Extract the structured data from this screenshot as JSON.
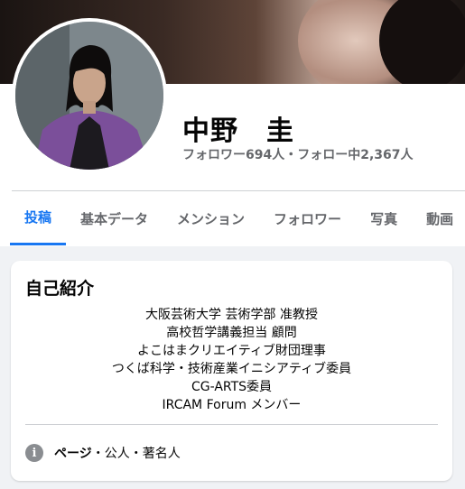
{
  "profile": {
    "name": "中野　圭",
    "follow_stats": "フォロワー694人・フォロー中2,367人"
  },
  "tabs": [
    {
      "label": "投稿",
      "active": true
    },
    {
      "label": "基本データ",
      "active": false
    },
    {
      "label": "メンション",
      "active": false
    },
    {
      "label": "フォロワー",
      "active": false
    },
    {
      "label": "写真",
      "active": false
    },
    {
      "label": "動画",
      "active": false
    }
  ],
  "intro": {
    "title": "自己紹介",
    "bio_lines": [
      "大阪芸術大学 芸術学部 准教授",
      "高校哲学講義担当 顧問",
      "よこはまクリエイティブ財団理事",
      "つくば科学・技術産業イニシアティブ委員",
      "CG-ARTS委員",
      "IRCAM Forum メンバー"
    ],
    "page_label": "ページ",
    "page_category": "・公人・著名人"
  },
  "colors": {
    "accent": "#1877f2",
    "secondary_text": "#65676b",
    "background": "#f0f2f5"
  },
  "icons": {
    "info": "info-icon"
  }
}
